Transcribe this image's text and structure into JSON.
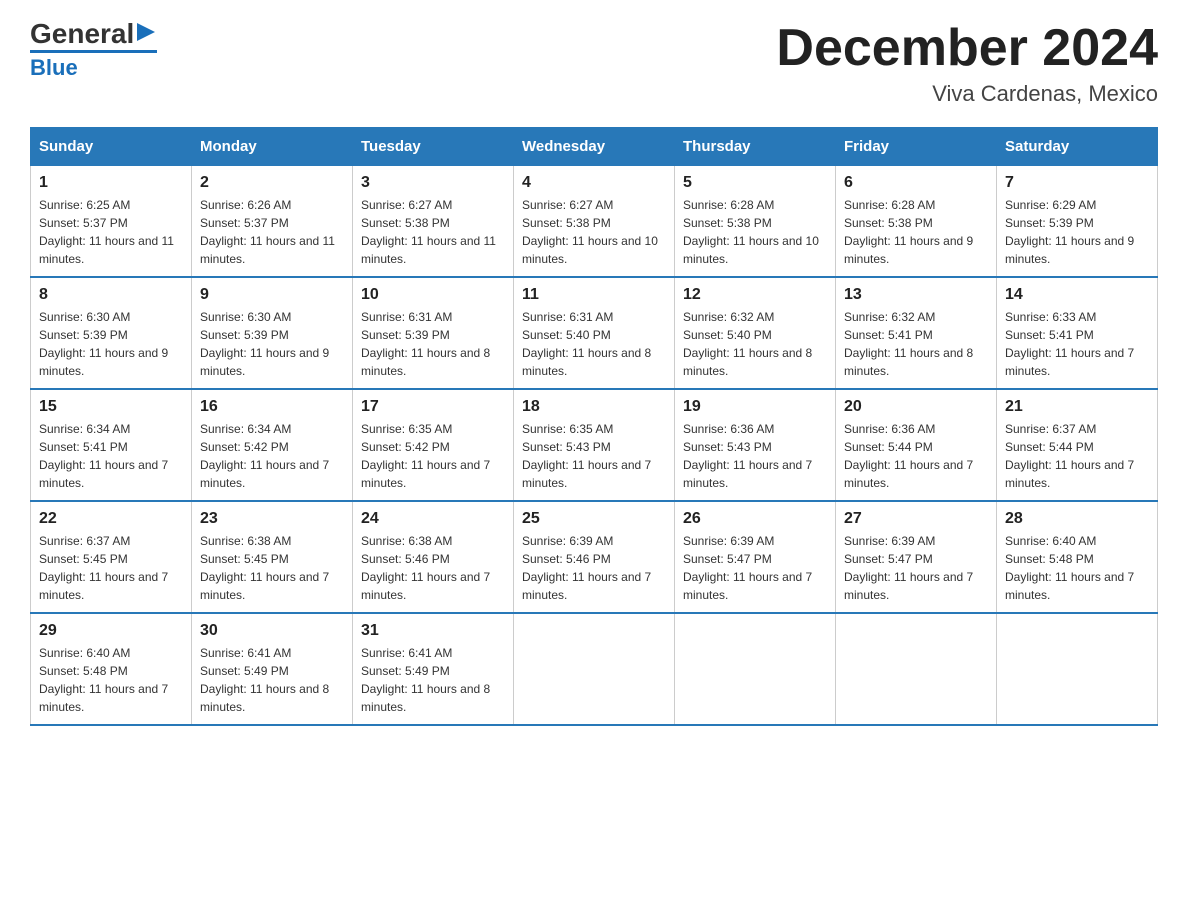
{
  "header": {
    "logo_general": "General",
    "logo_blue": "Blue",
    "month_title": "December 2024",
    "location": "Viva Cardenas, Mexico"
  },
  "days_of_week": [
    "Sunday",
    "Monday",
    "Tuesday",
    "Wednesday",
    "Thursday",
    "Friday",
    "Saturday"
  ],
  "weeks": [
    [
      {
        "day": "1",
        "sunrise": "6:25 AM",
        "sunset": "5:37 PM",
        "daylight": "11 hours and 11 minutes."
      },
      {
        "day": "2",
        "sunrise": "6:26 AM",
        "sunset": "5:37 PM",
        "daylight": "11 hours and 11 minutes."
      },
      {
        "day": "3",
        "sunrise": "6:27 AM",
        "sunset": "5:38 PM",
        "daylight": "11 hours and 11 minutes."
      },
      {
        "day": "4",
        "sunrise": "6:27 AM",
        "sunset": "5:38 PM",
        "daylight": "11 hours and 10 minutes."
      },
      {
        "day": "5",
        "sunrise": "6:28 AM",
        "sunset": "5:38 PM",
        "daylight": "11 hours and 10 minutes."
      },
      {
        "day": "6",
        "sunrise": "6:28 AM",
        "sunset": "5:38 PM",
        "daylight": "11 hours and 9 minutes."
      },
      {
        "day": "7",
        "sunrise": "6:29 AM",
        "sunset": "5:39 PM",
        "daylight": "11 hours and 9 minutes."
      }
    ],
    [
      {
        "day": "8",
        "sunrise": "6:30 AM",
        "sunset": "5:39 PM",
        "daylight": "11 hours and 9 minutes."
      },
      {
        "day": "9",
        "sunrise": "6:30 AM",
        "sunset": "5:39 PM",
        "daylight": "11 hours and 9 minutes."
      },
      {
        "day": "10",
        "sunrise": "6:31 AM",
        "sunset": "5:39 PM",
        "daylight": "11 hours and 8 minutes."
      },
      {
        "day": "11",
        "sunrise": "6:31 AM",
        "sunset": "5:40 PM",
        "daylight": "11 hours and 8 minutes."
      },
      {
        "day": "12",
        "sunrise": "6:32 AM",
        "sunset": "5:40 PM",
        "daylight": "11 hours and 8 minutes."
      },
      {
        "day": "13",
        "sunrise": "6:32 AM",
        "sunset": "5:41 PM",
        "daylight": "11 hours and 8 minutes."
      },
      {
        "day": "14",
        "sunrise": "6:33 AM",
        "sunset": "5:41 PM",
        "daylight": "11 hours and 7 minutes."
      }
    ],
    [
      {
        "day": "15",
        "sunrise": "6:34 AM",
        "sunset": "5:41 PM",
        "daylight": "11 hours and 7 minutes."
      },
      {
        "day": "16",
        "sunrise": "6:34 AM",
        "sunset": "5:42 PM",
        "daylight": "11 hours and 7 minutes."
      },
      {
        "day": "17",
        "sunrise": "6:35 AM",
        "sunset": "5:42 PM",
        "daylight": "11 hours and 7 minutes."
      },
      {
        "day": "18",
        "sunrise": "6:35 AM",
        "sunset": "5:43 PM",
        "daylight": "11 hours and 7 minutes."
      },
      {
        "day": "19",
        "sunrise": "6:36 AM",
        "sunset": "5:43 PM",
        "daylight": "11 hours and 7 minutes."
      },
      {
        "day": "20",
        "sunrise": "6:36 AM",
        "sunset": "5:44 PM",
        "daylight": "11 hours and 7 minutes."
      },
      {
        "day": "21",
        "sunrise": "6:37 AM",
        "sunset": "5:44 PM",
        "daylight": "11 hours and 7 minutes."
      }
    ],
    [
      {
        "day": "22",
        "sunrise": "6:37 AM",
        "sunset": "5:45 PM",
        "daylight": "11 hours and 7 minutes."
      },
      {
        "day": "23",
        "sunrise": "6:38 AM",
        "sunset": "5:45 PM",
        "daylight": "11 hours and 7 minutes."
      },
      {
        "day": "24",
        "sunrise": "6:38 AM",
        "sunset": "5:46 PM",
        "daylight": "11 hours and 7 minutes."
      },
      {
        "day": "25",
        "sunrise": "6:39 AM",
        "sunset": "5:46 PM",
        "daylight": "11 hours and 7 minutes."
      },
      {
        "day": "26",
        "sunrise": "6:39 AM",
        "sunset": "5:47 PM",
        "daylight": "11 hours and 7 minutes."
      },
      {
        "day": "27",
        "sunrise": "6:39 AM",
        "sunset": "5:47 PM",
        "daylight": "11 hours and 7 minutes."
      },
      {
        "day": "28",
        "sunrise": "6:40 AM",
        "sunset": "5:48 PM",
        "daylight": "11 hours and 7 minutes."
      }
    ],
    [
      {
        "day": "29",
        "sunrise": "6:40 AM",
        "sunset": "5:48 PM",
        "daylight": "11 hours and 7 minutes."
      },
      {
        "day": "30",
        "sunrise": "6:41 AM",
        "sunset": "5:49 PM",
        "daylight": "11 hours and 8 minutes."
      },
      {
        "day": "31",
        "sunrise": "6:41 AM",
        "sunset": "5:49 PM",
        "daylight": "11 hours and 8 minutes."
      },
      null,
      null,
      null,
      null
    ]
  ]
}
